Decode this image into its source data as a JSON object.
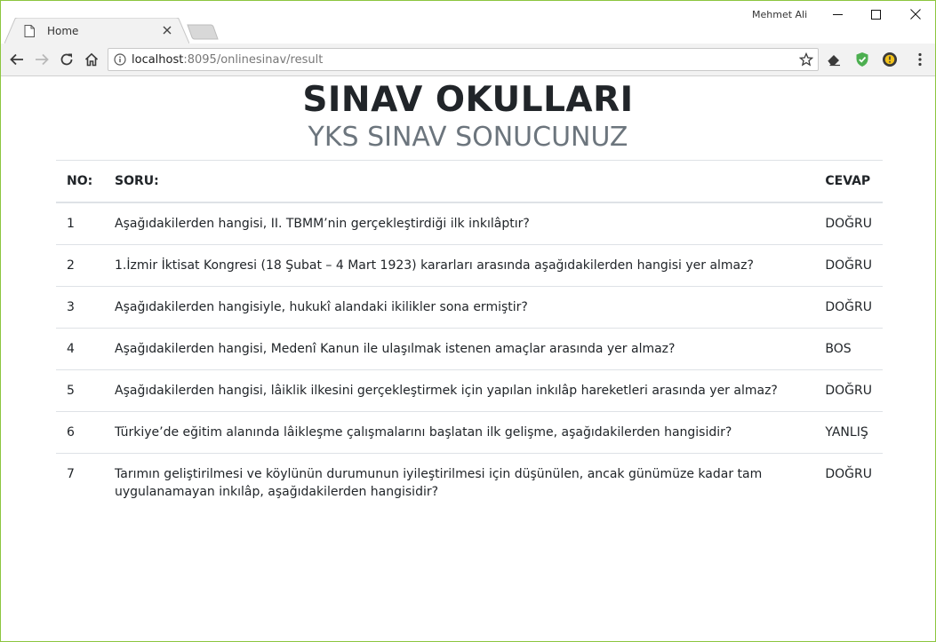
{
  "browser": {
    "tab_title": "Home",
    "profile_name": "Mehmet Ali",
    "url_host": "localhost",
    "url_rest": ":8095/onlinesinav/result"
  },
  "page": {
    "title": "SINAV OKULLARI",
    "subtitle": "YKS SINAV SONUCUNUZ",
    "table": {
      "headers": {
        "no": "NO:",
        "question": "SORU:",
        "answer": "CEVAP"
      },
      "rows": [
        {
          "no": "1",
          "question": "Aşağıdakilerden hangisi, II. TBMM’nin gerçekleştirdiği ilk inkılâptır?",
          "answer": "DOĞRU"
        },
        {
          "no": "2",
          "question": "1.İzmir İktisat Kongresi (18 Şubat – 4 Mart 1923) kararları arasında aşağıdakilerden hangisi yer almaz?",
          "answer": "DOĞRU"
        },
        {
          "no": "3",
          "question": "Aşağıdakilerden hangisiyle, hukukî alandaki ikilikler sona ermiştir?",
          "answer": "DOĞRU"
        },
        {
          "no": "4",
          "question": "Aşağıdakilerden hangisi, Medenî Kanun ile ulaşılmak istenen amaçlar arasında yer almaz?",
          "answer": "BOS"
        },
        {
          "no": "5",
          "question": "Aşağıdakilerden hangisi, lâiklik ilkesini gerçekleştirmek için yapılan inkılâp hareketleri arasında yer almaz?",
          "answer": "DOĞRU"
        },
        {
          "no": "6",
          "question": "Türkiye’de eğitim alanında lâikleşme çalışmalarını başlatan ilk gelişme, aşağıdakilerden hangisidir?",
          "answer": "YANLIŞ"
        },
        {
          "no": "7",
          "question": "Tarımın geliştirilmesi ve köylünün durumunun iyileştirilmesi için düşünülen, ancak günümüze kadar tam uygulanamayan inkılâp, aşağıdakilerden hangisidir?",
          "answer": "DOĞRU"
        }
      ]
    }
  },
  "colors": {
    "window_border": "#8cc63f",
    "toolbar_bg": "#f2f2f2",
    "text": "#212529",
    "muted": "#6c757d",
    "table_border": "#dee2e6"
  },
  "icons": {
    "tab": "page-icon",
    "close": "close-icon",
    "back": "back-arrow-icon",
    "forward": "forward-arrow-icon",
    "reload": "reload-icon",
    "home": "home-icon",
    "info": "info-icon",
    "star": "star-icon",
    "eraser": "eraser-extension-icon",
    "shield": "shield-extension-icon",
    "badge": "badge-extension-icon"
  }
}
